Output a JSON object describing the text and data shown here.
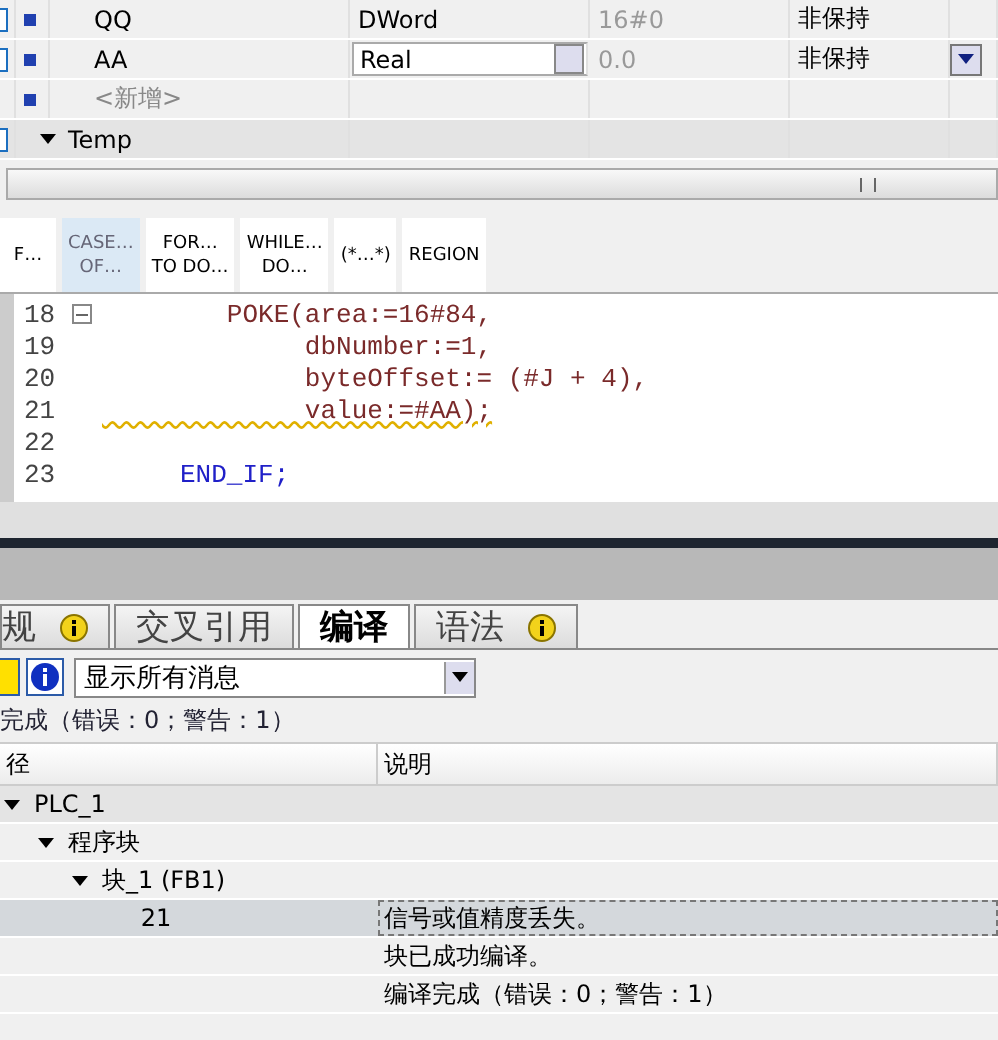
{
  "var_table": {
    "rows": [
      {
        "kind": "var",
        "name": "QQ",
        "type": "DWord",
        "default": "16#0",
        "retain": "非保持",
        "editing": false
      },
      {
        "kind": "var",
        "name": "AA",
        "type": "Real",
        "default": "0.0",
        "retain": "非保持",
        "editing": true
      },
      {
        "kind": "add",
        "name": "<新增>"
      },
      {
        "kind": "section",
        "name": "Temp",
        "expanded": true
      }
    ]
  },
  "toolbar": {
    "buttons": [
      {
        "lines": [
          "F…"
        ],
        "selected": false
      },
      {
        "lines": [
          "CASE…",
          "OF…"
        ],
        "selected": true
      },
      {
        "lines": [
          "FOR…",
          "TO DO…"
        ],
        "selected": false
      },
      {
        "lines": [
          "WHILE…",
          "DO…"
        ],
        "selected": false
      },
      {
        "lines": [
          "(*…*)"
        ],
        "selected": false
      },
      {
        "lines": [
          "REGION"
        ],
        "selected": false
      }
    ]
  },
  "code": {
    "lines": [
      {
        "number": "18",
        "text": "        POKE(area:=16#84,",
        "kind": "call",
        "fold": true
      },
      {
        "number": "19",
        "text": "             dbNumber:=1,",
        "kind": "call"
      },
      {
        "number": "20",
        "text": "             byteOffset:= (#J + 4),",
        "kind": "call"
      },
      {
        "number": "21",
        "text": "             value:=#AA);",
        "kind": "call",
        "warning": true
      },
      {
        "number": "22"
      },
      {
        "number": "23",
        "text": "     END_IF;",
        "kind": "keyword"
      }
    ]
  },
  "messages": {
    "tabs": [
      {
        "label": "规",
        "info": true,
        "selected": false
      },
      {
        "label": "交叉引用",
        "info": false,
        "selected": false
      },
      {
        "label": "编译",
        "info": false,
        "selected": true
      },
      {
        "label": "语法",
        "info": true,
        "selected": false
      }
    ],
    "filter": "显示所有消息",
    "summary": "完成（错误：0；警告：1）",
    "columns": [
      "径",
      "说明"
    ],
    "rows": [
      {
        "path": "PLC_1",
        "expanded": true,
        "selected": false,
        "children": [
          {
            "path": "程序块",
            "expanded": true,
            "selected": false,
            "children": [
              {
                "path": "块_1 (FB1)",
                "expanded": true,
                "selected": false,
                "children": [
                  {
                    "path": "21",
                    "description": "信号或值精度丢失。",
                    "selected": true
                  }
                ]
              }
            ]
          }
        ]
      },
      {
        "description": "块已成功编译。",
        "selected": false
      },
      {
        "description": "编译完成（错误：0；警告：1）",
        "selected": false
      }
    ]
  }
}
